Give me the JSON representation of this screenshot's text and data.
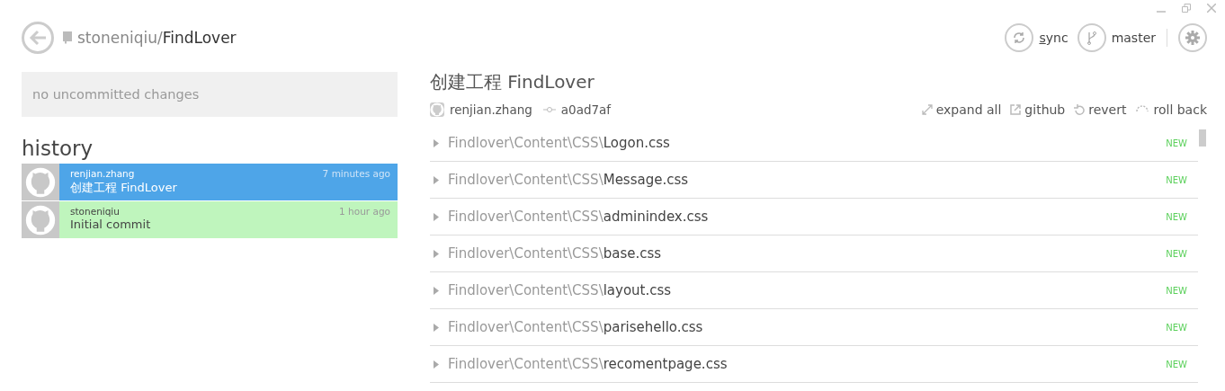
{
  "repo": {
    "owner": "stoneniqiu/",
    "name": "FindLover"
  },
  "toolbar": {
    "sync": "sync",
    "branch": "master"
  },
  "changes": {
    "placeholder": "no uncommitted changes"
  },
  "history": {
    "title": "history",
    "commits": [
      {
        "author": "renjian.zhang",
        "time": "7 minutes ago",
        "message": "创建工程 FindLover",
        "selected": true
      },
      {
        "author": "stoneniqiu",
        "time": "1 hour ago",
        "message": "Initial commit",
        "selected": false
      }
    ]
  },
  "commit": {
    "title": "创建工程 FindLover",
    "author": "renjian.zhang",
    "sha": "a0ad7af",
    "actions": [
      {
        "kind": "expand",
        "label": "expand all"
      },
      {
        "kind": "external",
        "label": "github"
      },
      {
        "kind": "revert",
        "label": "revert"
      },
      {
        "kind": "rollback",
        "label": "roll back"
      }
    ],
    "files": [
      {
        "dir": "Findlover\\Content\\CSS\\",
        "name": "Logon.css",
        "status": "NEW"
      },
      {
        "dir": "Findlover\\Content\\CSS\\",
        "name": "Message.css",
        "status": "NEW"
      },
      {
        "dir": "Findlover\\Content\\CSS\\",
        "name": "adminindex.css",
        "status": "NEW"
      },
      {
        "dir": "Findlover\\Content\\CSS\\",
        "name": "base.css",
        "status": "NEW"
      },
      {
        "dir": "Findlover\\Content\\CSS\\",
        "name": "layout.css",
        "status": "NEW"
      },
      {
        "dir": "Findlover\\Content\\CSS\\",
        "name": "parisehello.css",
        "status": "NEW"
      },
      {
        "dir": "Findlover\\Content\\CSS\\",
        "name": "recomentpage.css",
        "status": "NEW"
      }
    ]
  }
}
